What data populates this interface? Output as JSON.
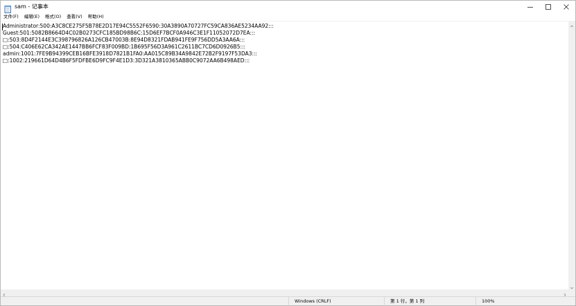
{
  "window": {
    "title": "sam - 记事本",
    "icons": {
      "app": "notepad-icon",
      "minimize": "minimize-icon",
      "maximize": "maximize-icon",
      "close": "close-icon"
    }
  },
  "menu": {
    "items": [
      {
        "label": "文件(F)"
      },
      {
        "label": "编辑(E)"
      },
      {
        "label": "格式(O)"
      },
      {
        "label": "查看(V)"
      },
      {
        "label": "帮助(H)"
      }
    ]
  },
  "editor": {
    "lines": [
      "Administrator:500:A3C8CE275F5B78E2D17E94C5552F6590:30A3890A70727FC59CA836AE5234AA92:::",
      "Guest:501:5082B8664D4C02B0273CFC185BD98B6C:15D6EF7BCF0A946C3E1F11052072D7EA:::",
      "□:503:8D4F2144E3C398796826A126CB47003B:8E94D8321FDAB941FE9F756DD5A3AA6A:::",
      "□:504:C406E62CA342AE1447BB6FCF83F009BD:1B695F56D3A961C2611BC7CD6D0926B5:::",
      "admin:1001:7FE9B94399CEB16BFE3918D7821B1FA0:AA015C89B34A9842E72B2F9197F53DA3:::",
      "□:1002:219661D64D4B6F5FDFBE6D9FC9F4E1D3:3D321A3810365ABB0C9072AA6B498AED:::"
    ]
  },
  "statusbar": {
    "encoding": "Windows (CRLF)",
    "position": "第 1 行，第 1 列",
    "zoom": "100%"
  },
  "colors": {
    "chrome": "#f0f0f0",
    "border": "#d7d7d7",
    "text": "#000000",
    "background": "#ffffff"
  }
}
